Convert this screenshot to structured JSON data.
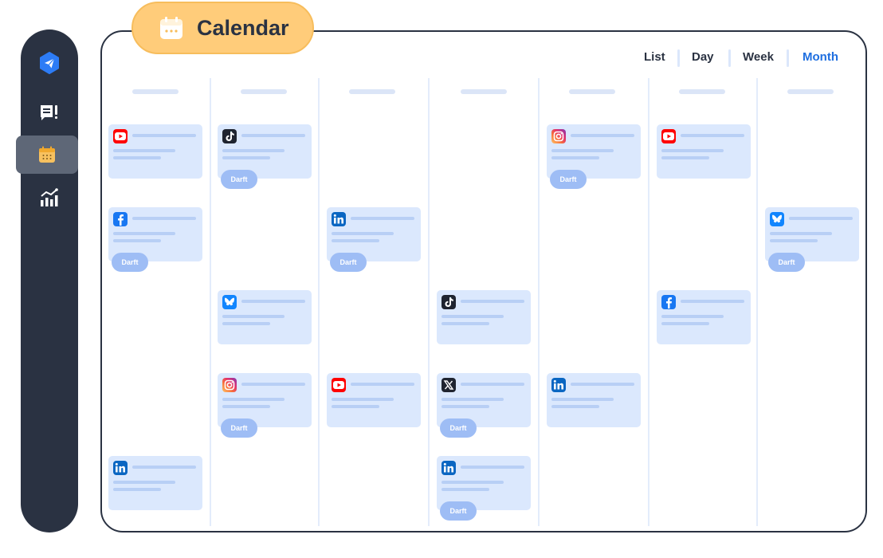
{
  "sidebar": {
    "items": [
      {
        "name": "send",
        "icon": "paper-plane-icon"
      },
      {
        "name": "posts",
        "icon": "post-list-icon"
      },
      {
        "name": "calendar",
        "icon": "calendar-icon",
        "active": true
      },
      {
        "name": "analytics",
        "icon": "bar-chart-icon"
      }
    ]
  },
  "header": {
    "badge_label": "Calendar",
    "tabs": [
      {
        "label": "List",
        "active": false
      },
      {
        "label": "Day",
        "active": false
      },
      {
        "label": "Week",
        "active": false
      },
      {
        "label": "Month",
        "active": true
      }
    ]
  },
  "calendar": {
    "draft_label": "Darft",
    "columns": [
      {
        "cards": [
          {
            "network": "youtube",
            "draft": false
          },
          {
            "network": "facebook",
            "draft": true
          },
          {
            "network": "linkedin",
            "draft": false
          }
        ]
      },
      {
        "cards": [
          {
            "network": "tiktok",
            "draft": true
          },
          {
            "network": "bluesky",
            "draft": false
          },
          {
            "network": "instagram",
            "draft": true
          }
        ]
      },
      {
        "cards": [
          {
            "network": "linkedin",
            "draft": true
          },
          {
            "network": "youtube",
            "draft": false
          }
        ]
      },
      {
        "cards": [
          {
            "network": "tiktok",
            "draft": false
          },
          {
            "network": "x",
            "draft": true
          },
          {
            "network": "linkedin",
            "draft": true
          }
        ]
      },
      {
        "cards": [
          {
            "network": "instagram",
            "draft": true
          },
          {
            "network": "linkedin",
            "draft": false
          }
        ]
      },
      {
        "cards": [
          {
            "network": "youtube",
            "draft": false
          },
          {
            "network": "facebook",
            "draft": false
          }
        ]
      },
      {
        "cards": [
          {
            "network": "bluesky",
            "draft": true
          }
        ]
      }
    ]
  },
  "colors": {
    "sidebar_bg": "#2a3242",
    "active_item_bg": "#5e6777",
    "badge_bg": "#ffcc7a",
    "accent_blue": "#1f6fe0",
    "card_bg": "#dbe8fd",
    "draft_bg": "#9ebdf5"
  }
}
